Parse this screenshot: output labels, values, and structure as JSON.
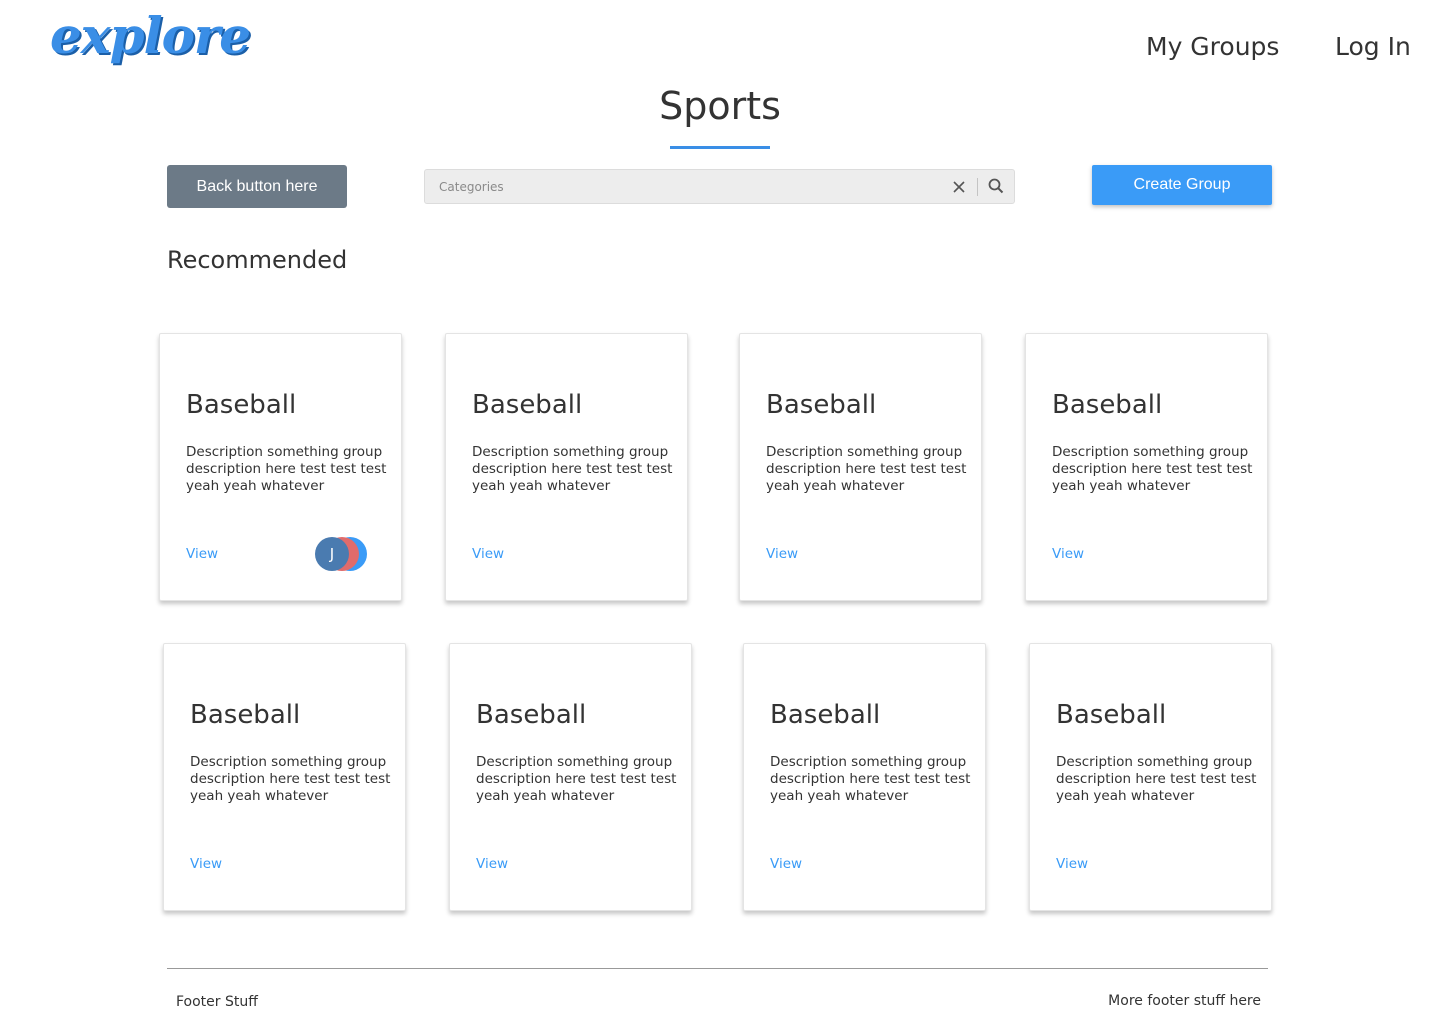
{
  "header": {
    "logo_text": "explore",
    "nav": [
      {
        "label": "My Groups"
      },
      {
        "label": "Log In"
      }
    ]
  },
  "page": {
    "title": "Sports"
  },
  "toolbar": {
    "back_label": "Back button here",
    "search_placeholder": "Categories",
    "search_value": "",
    "create_label": "Create Group"
  },
  "section": {
    "heading": "Recommended"
  },
  "cards": [
    {
      "title": "Baseball",
      "description": "Description something group description here test test test yeah yeah whatever",
      "view_label": "View",
      "avatar_initial": "J"
    },
    {
      "title": "Baseball",
      "description": "Description something group description here test test test yeah yeah whatever",
      "view_label": "View"
    },
    {
      "title": "Baseball",
      "description": "Description something group description here test test test yeah yeah whatever",
      "view_label": "View"
    },
    {
      "title": "Baseball",
      "description": "Description something group description here test test test yeah yeah whatever",
      "view_label": "View"
    },
    {
      "title": "Baseball",
      "description": "Description something group description here test test test yeah yeah whatever",
      "view_label": "View"
    },
    {
      "title": "Baseball",
      "description": "Description something group description here test test test yeah yeah whatever",
      "view_label": "View"
    },
    {
      "title": "Baseball",
      "description": "Description something group description here test test test yeah yeah whatever",
      "view_label": "View"
    },
    {
      "title": "Baseball",
      "description": "Description something group description here test test test yeah yeah whatever",
      "view_label": "View"
    }
  ],
  "footer": {
    "left": "Footer Stuff",
    "right": "More footer stuff here"
  },
  "icons": {
    "clear": "close-icon",
    "search": "search-icon"
  },
  "colors": {
    "accent": "#3a9bf7",
    "back_button": "#6c7a87",
    "search_bg": "#ededed"
  }
}
